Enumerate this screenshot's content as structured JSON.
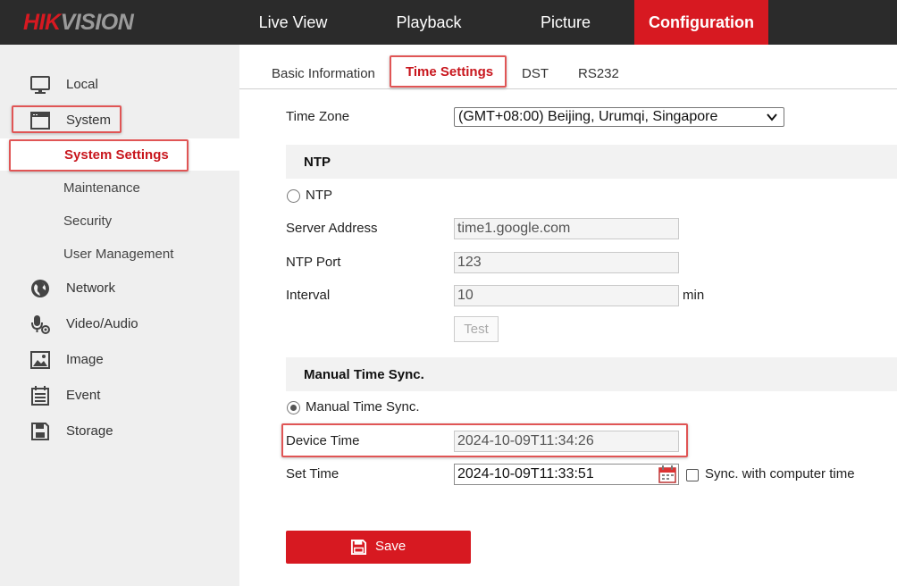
{
  "header": {
    "logo_part1": "HIK",
    "logo_part2": "VISION",
    "nav": [
      "Live View",
      "Playback",
      "Picture",
      "Configuration"
    ],
    "active_nav": "Configuration",
    "accent_color": "#d71921"
  },
  "sidebar": {
    "items": [
      {
        "label": "Local",
        "icon": "monitor-icon"
      },
      {
        "label": "System",
        "icon": "window-icon"
      },
      {
        "label": "Network",
        "icon": "globe-icon"
      },
      {
        "label": "Video/Audio",
        "icon": "microphone-camera-icon"
      },
      {
        "label": "Image",
        "icon": "image-icon"
      },
      {
        "label": "Event",
        "icon": "calendar-list-icon"
      },
      {
        "label": "Storage",
        "icon": "floppy-disk-icon"
      }
    ],
    "system_subitems": [
      "System Settings",
      "Maintenance",
      "Security",
      "User Management"
    ],
    "active_subitem": "System Settings"
  },
  "tabs": [
    "Basic Information",
    "Time Settings",
    "DST",
    "RS232"
  ],
  "active_tab": "Time Settings",
  "form": {
    "time_zone_label": "Time Zone",
    "time_zone_value": "(GMT+08:00) Beijing, Urumqi, Singapore",
    "ntp_section_title": "NTP",
    "ntp_radio_label": "NTP",
    "ntp_selected": false,
    "server_address_label": "Server Address",
    "server_address_value": "time1.google.com",
    "ntp_port_label": "NTP Port",
    "ntp_port_value": "123",
    "interval_label": "Interval",
    "interval_value": "10",
    "interval_unit": "min",
    "test_button": "Test",
    "manual_section_title": "Manual Time Sync.",
    "manual_radio_label": "Manual Time Sync.",
    "manual_selected": true,
    "device_time_label": "Device Time",
    "device_time_value": "2024-10-09T11:34:26",
    "set_time_label": "Set Time",
    "set_time_value": "2024-10-09T11:33:51",
    "sync_checkbox_label": "Sync. with computer time",
    "sync_checked": false,
    "save_button": "Save"
  }
}
